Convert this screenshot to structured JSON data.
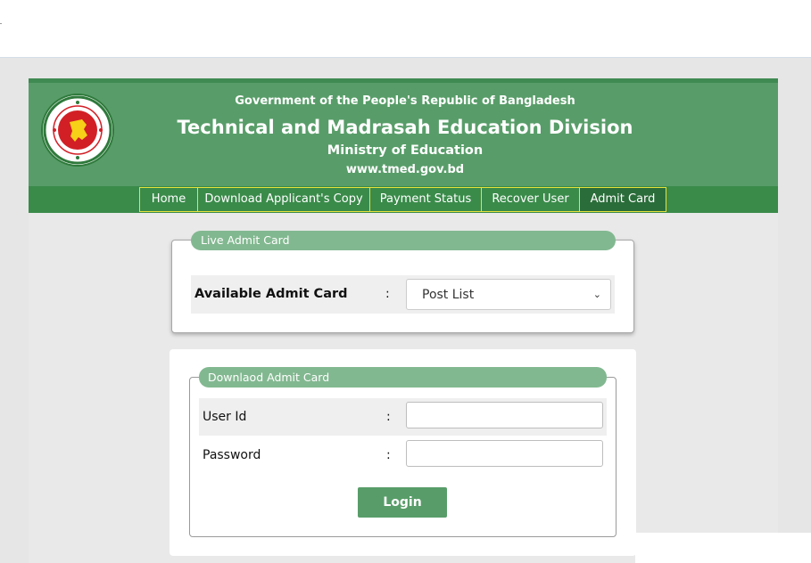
{
  "header": {
    "government": "Government of the People's Republic of Bangladesh",
    "title": "Technical and Madrasah Education Division",
    "ministry": "Ministry of Education",
    "url": "www.tmed.gov.bd"
  },
  "nav": {
    "items": [
      {
        "label": "Home"
      },
      {
        "label": "Download Applicant's Copy"
      },
      {
        "label": "Payment Status"
      },
      {
        "label": "Recover User"
      },
      {
        "label": "Admit Card",
        "active": true
      }
    ]
  },
  "live_admit": {
    "legend": "Live Admit Card",
    "label": "Available Admit Card",
    "colon": ":",
    "select_value": "Post List"
  },
  "download_admit": {
    "legend": "Downlaod Admit Card",
    "user_label": "User Id",
    "password_label": "Password",
    "colon": ":",
    "user_value": "",
    "password_value": "",
    "login_label": "Login"
  },
  "colors": {
    "header_green": "#589d69",
    "nav_green": "#3a8b4a",
    "nav_border": "#e7e23c",
    "legend_green": "#82b890"
  }
}
